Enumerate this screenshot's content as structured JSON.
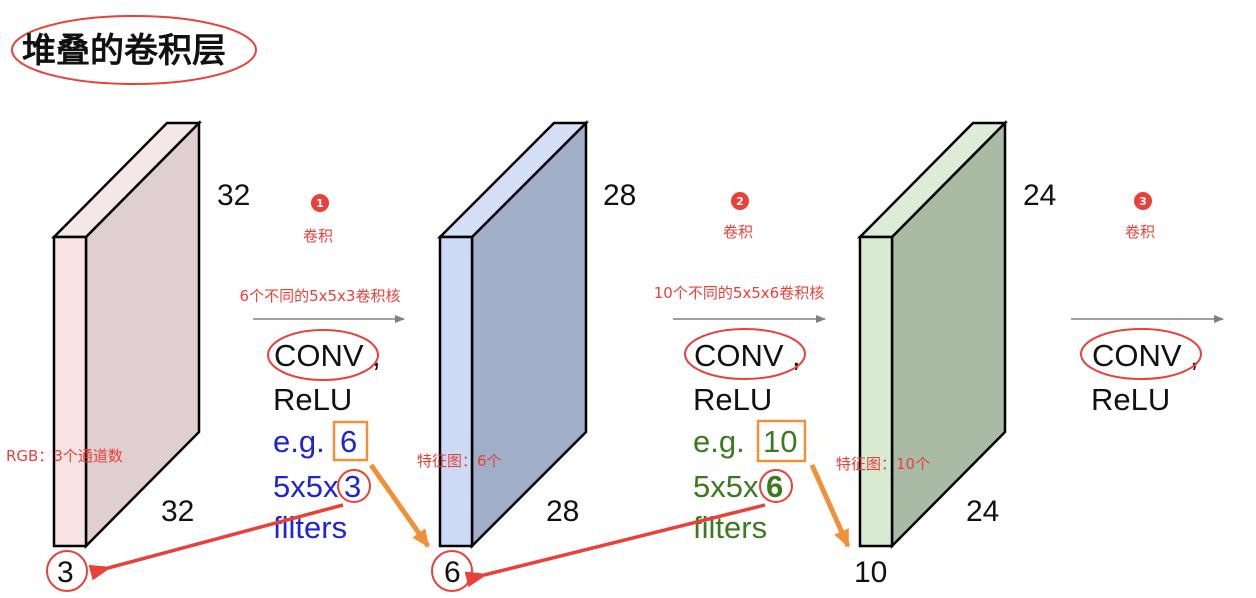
{
  "title": "堆叠的卷积层",
  "volumes": [
    {
      "height_label": "32",
      "width_label": "32",
      "depth_label": "3",
      "depth_circled": true,
      "front_color": "#f7e3e4",
      "side_color": "#dfcfd0"
    },
    {
      "height_label": "28",
      "width_label": "28",
      "depth_label": "6",
      "depth_circled": true,
      "front_color": "#cddaf5",
      "side_color": "#a0aec8"
    },
    {
      "height_label": "24",
      "width_label": "24",
      "depth_label": "10",
      "depth_circled": false,
      "front_color": "#d9ead3",
      "side_color": "#aabba5"
    }
  ],
  "steps": [
    {
      "number": "1",
      "conv_label": "卷积",
      "kernel_desc": "6个不同的5x5x3卷积核",
      "op_line1": "CONV",
      "op_comma": ",",
      "op_line2": "ReLU",
      "eg_prefix": "e.g. ",
      "eg_count": "6",
      "filter_prefix": "5x5x",
      "filter_depth": "3",
      "filters_word": "filters",
      "text_color": "#1f24d4"
    },
    {
      "number": "2",
      "conv_label": "卷积",
      "kernel_desc": "10个不同的5x5x6卷积核",
      "op_line1": "CONV",
      "op_comma": ",",
      "op_line2": "ReLU",
      "eg_prefix": "e.g. ",
      "eg_count": "10",
      "filter_prefix": "5x5x",
      "filter_depth": "6",
      "filters_word": "filters",
      "text_color": "#3c7a1f"
    },
    {
      "number": "3",
      "conv_label": "卷积",
      "op_line1": "CONV",
      "op_comma": ",",
      "op_line2": "ReLU"
    }
  ],
  "annotations": {
    "rgb_channels": "RGB：3个通道数",
    "feature_map_1": "特征图：6个",
    "feature_map_2": "特征图：10个"
  },
  "colors": {
    "annotation_red": "#e8413a",
    "highlight_orange": "#f0913a",
    "arrow_gray": "#808080"
  }
}
